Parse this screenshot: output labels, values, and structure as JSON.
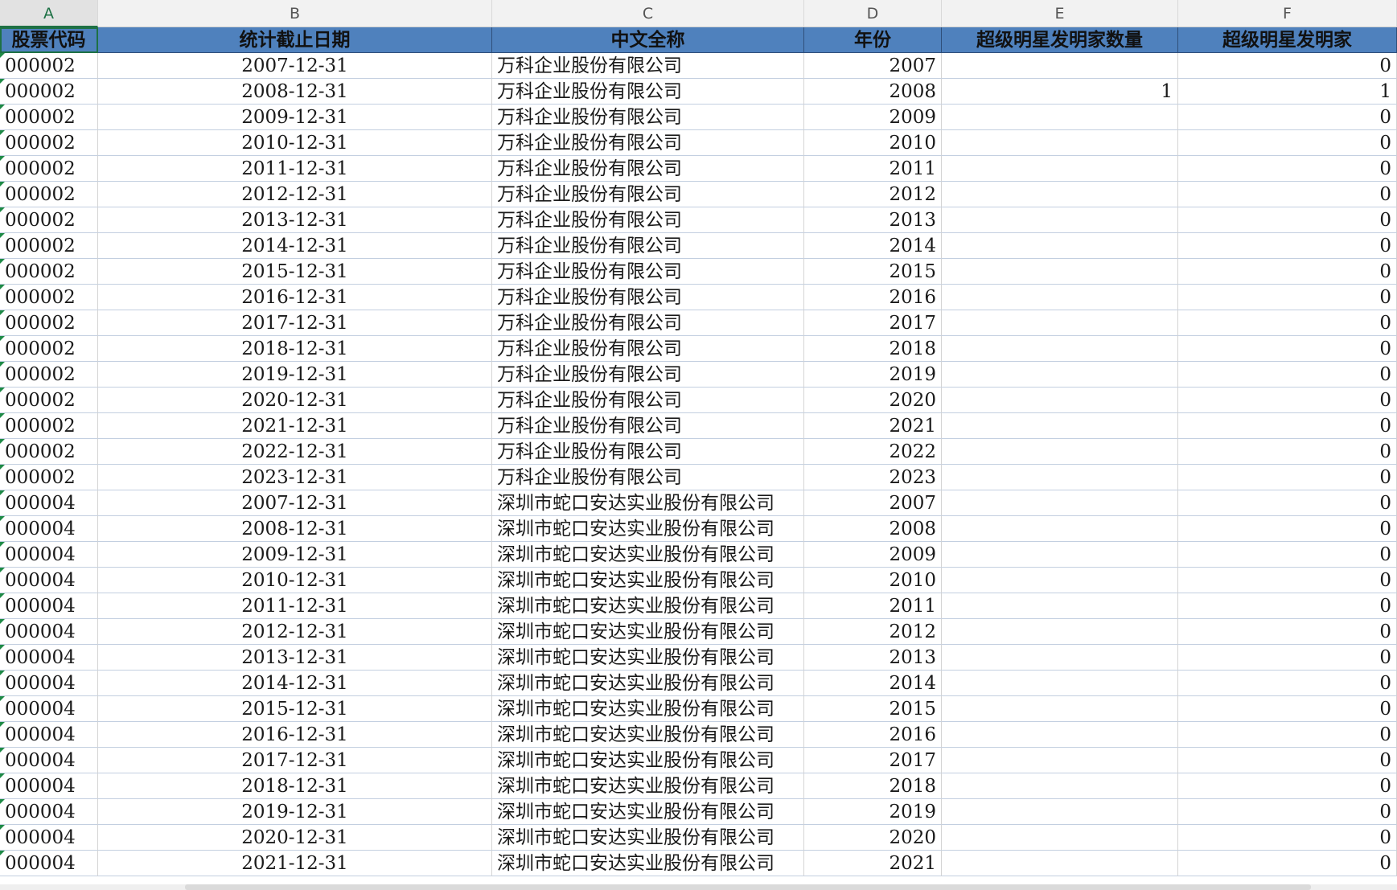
{
  "columns": [
    "A",
    "B",
    "C",
    "D",
    "E",
    "F"
  ],
  "headers": [
    "股票代码",
    "统计截止日期",
    "中文全称",
    "年份",
    "超级明星发明家数量",
    "超级明星发明家"
  ],
  "rows": [
    [
      "000002",
      "2007-12-31",
      "万科企业股份有限公司",
      "2007",
      "",
      "0"
    ],
    [
      "000002",
      "2008-12-31",
      "万科企业股份有限公司",
      "2008",
      "1",
      "1"
    ],
    [
      "000002",
      "2009-12-31",
      "万科企业股份有限公司",
      "2009",
      "",
      "0"
    ],
    [
      "000002",
      "2010-12-31",
      "万科企业股份有限公司",
      "2010",
      "",
      "0"
    ],
    [
      "000002",
      "2011-12-31",
      "万科企业股份有限公司",
      "2011",
      "",
      "0"
    ],
    [
      "000002",
      "2012-12-31",
      "万科企业股份有限公司",
      "2012",
      "",
      "0"
    ],
    [
      "000002",
      "2013-12-31",
      "万科企业股份有限公司",
      "2013",
      "",
      "0"
    ],
    [
      "000002",
      "2014-12-31",
      "万科企业股份有限公司",
      "2014",
      "",
      "0"
    ],
    [
      "000002",
      "2015-12-31",
      "万科企业股份有限公司",
      "2015",
      "",
      "0"
    ],
    [
      "000002",
      "2016-12-31",
      "万科企业股份有限公司",
      "2016",
      "",
      "0"
    ],
    [
      "000002",
      "2017-12-31",
      "万科企业股份有限公司",
      "2017",
      "",
      "0"
    ],
    [
      "000002",
      "2018-12-31",
      "万科企业股份有限公司",
      "2018",
      "",
      "0"
    ],
    [
      "000002",
      "2019-12-31",
      "万科企业股份有限公司",
      "2019",
      "",
      "0"
    ],
    [
      "000002",
      "2020-12-31",
      "万科企业股份有限公司",
      "2020",
      "",
      "0"
    ],
    [
      "000002",
      "2021-12-31",
      "万科企业股份有限公司",
      "2021",
      "",
      "0"
    ],
    [
      "000002",
      "2022-12-31",
      "万科企业股份有限公司",
      "2022",
      "",
      "0"
    ],
    [
      "000002",
      "2023-12-31",
      "万科企业股份有限公司",
      "2023",
      "",
      "0"
    ],
    [
      "000004",
      "2007-12-31",
      "深圳市蛇口安达实业股份有限公司",
      "2007",
      "",
      "0"
    ],
    [
      "000004",
      "2008-12-31",
      "深圳市蛇口安达实业股份有限公司",
      "2008",
      "",
      "0"
    ],
    [
      "000004",
      "2009-12-31",
      "深圳市蛇口安达实业股份有限公司",
      "2009",
      "",
      "0"
    ],
    [
      "000004",
      "2010-12-31",
      "深圳市蛇口安达实业股份有限公司",
      "2010",
      "",
      "0"
    ],
    [
      "000004",
      "2011-12-31",
      "深圳市蛇口安达实业股份有限公司",
      "2011",
      "",
      "0"
    ],
    [
      "000004",
      "2012-12-31",
      "深圳市蛇口安达实业股份有限公司",
      "2012",
      "",
      "0"
    ],
    [
      "000004",
      "2013-12-31",
      "深圳市蛇口安达实业股份有限公司",
      "2013",
      "",
      "0"
    ],
    [
      "000004",
      "2014-12-31",
      "深圳市蛇口安达实业股份有限公司",
      "2014",
      "",
      "0"
    ],
    [
      "000004",
      "2015-12-31",
      "深圳市蛇口安达实业股份有限公司",
      "2015",
      "",
      "0"
    ],
    [
      "000004",
      "2016-12-31",
      "深圳市蛇口安达实业股份有限公司",
      "2016",
      "",
      "0"
    ],
    [
      "000004",
      "2017-12-31",
      "深圳市蛇口安达实业股份有限公司",
      "2017",
      "",
      "0"
    ],
    [
      "000004",
      "2018-12-31",
      "深圳市蛇口安达实业股份有限公司",
      "2018",
      "",
      "0"
    ],
    [
      "000004",
      "2019-12-31",
      "深圳市蛇口安达实业股份有限公司",
      "2019",
      "",
      "0"
    ],
    [
      "000004",
      "2020-12-31",
      "深圳市蛇口安达实业股份有限公司",
      "2020",
      "",
      "0"
    ],
    [
      "000004",
      "2021-12-31",
      "深圳市蛇口安达实业股份有限公司",
      "2021",
      "",
      "0"
    ]
  ]
}
